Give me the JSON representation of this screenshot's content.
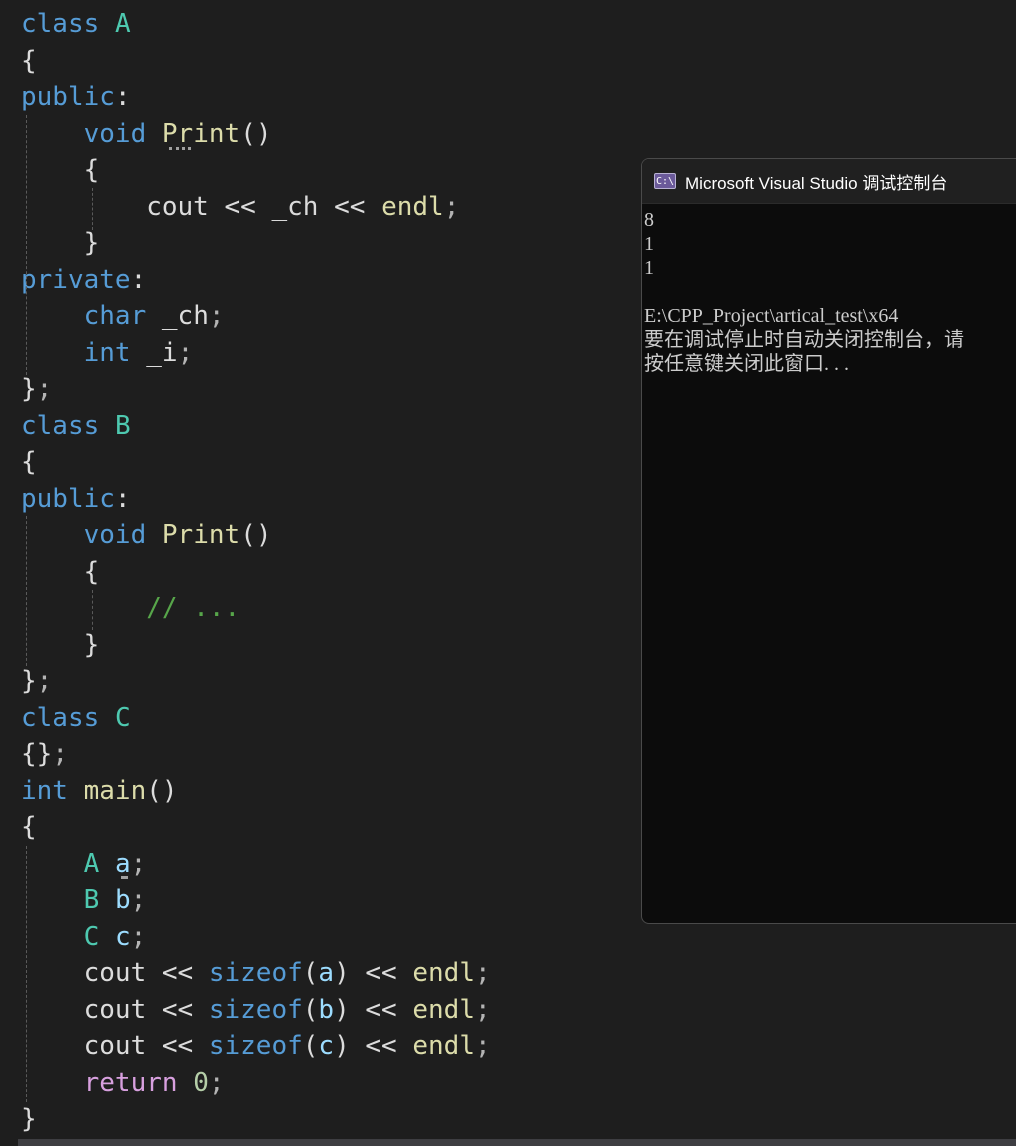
{
  "editor": {
    "lines": [
      {
        "tokens": [
          {
            "text": "class",
            "color": "#569cd6"
          },
          {
            "text": " "
          },
          {
            "text": "A",
            "color": "#4ec9b0"
          }
        ]
      },
      {
        "tokens": [
          {
            "text": "{"
          }
        ]
      },
      {
        "tokens": [
          {
            "text": "public",
            "color": "#569cd6"
          },
          {
            "text": ":"
          }
        ]
      },
      {
        "tokens": [
          {
            "text": "    "
          },
          {
            "text": "void",
            "color": "#569cd6"
          },
          {
            "text": " "
          },
          {
            "text": "Print",
            "color": "#dcdcaa"
          },
          {
            "text": "()"
          }
        ]
      },
      {
        "tokens": [
          {
            "text": "    {"
          }
        ]
      },
      {
        "tokens": [
          {
            "text": "        cout",
            "color": "#dcdcdc"
          },
          {
            "text": " << "
          },
          {
            "text": "_ch",
            "color": "#dadada"
          },
          {
            "text": " << "
          },
          {
            "text": "endl",
            "color": "#dcdcaa"
          },
          {
            "text": ";",
            "color": "#b4b4b4"
          }
        ]
      },
      {
        "tokens": [
          {
            "text": "    }"
          }
        ]
      },
      {
        "tokens": [
          {
            "text": "private",
            "color": "#569cd6"
          },
          {
            "text": ":"
          }
        ]
      },
      {
        "tokens": [
          {
            "text": "    "
          },
          {
            "text": "char",
            "color": "#569cd6"
          },
          {
            "text": " _ch"
          },
          {
            "text": ";",
            "color": "#b4b4b4"
          }
        ]
      },
      {
        "tokens": [
          {
            "text": "    "
          },
          {
            "text": "int",
            "color": "#569cd6"
          },
          {
            "text": " _i"
          },
          {
            "text": ";",
            "color": "#b4b4b4"
          }
        ]
      },
      {
        "tokens": [
          {
            "text": "}"
          },
          {
            "text": ";",
            "color": "#b4b4b4"
          }
        ]
      },
      {
        "tokens": [
          {
            "text": "class",
            "color": "#569cd6"
          },
          {
            "text": " "
          },
          {
            "text": "B",
            "color": "#4ec9b0"
          }
        ]
      },
      {
        "tokens": [
          {
            "text": "{"
          }
        ]
      },
      {
        "tokens": [
          {
            "text": "public",
            "color": "#569cd6"
          },
          {
            "text": ":"
          }
        ]
      },
      {
        "tokens": [
          {
            "text": "    "
          },
          {
            "text": "void",
            "color": "#569cd6"
          },
          {
            "text": " "
          },
          {
            "text": "Print",
            "color": "#dcdcaa"
          },
          {
            "text": "()"
          }
        ]
      },
      {
        "tokens": [
          {
            "text": "    {"
          }
        ]
      },
      {
        "tokens": [
          {
            "text": "        "
          },
          {
            "text": "// ...",
            "color": "#57a64a"
          }
        ]
      },
      {
        "tokens": [
          {
            "text": "    }"
          }
        ]
      },
      {
        "tokens": [
          {
            "text": "}"
          },
          {
            "text": ";",
            "color": "#b4b4b4"
          }
        ]
      },
      {
        "tokens": [
          {
            "text": "class",
            "color": "#569cd6"
          },
          {
            "text": " "
          },
          {
            "text": "C",
            "color": "#4ec9b0"
          }
        ]
      },
      {
        "tokens": [
          {
            "text": "{}"
          },
          {
            "text": ";",
            "color": "#b4b4b4"
          }
        ]
      },
      {
        "tokens": [
          {
            "text": "int",
            "color": "#569cd6"
          },
          {
            "text": " "
          },
          {
            "text": "main",
            "color": "#dcdcaa"
          },
          {
            "text": "()"
          }
        ]
      },
      {
        "tokens": [
          {
            "text": "{"
          }
        ]
      },
      {
        "tokens": [
          {
            "text": "    "
          },
          {
            "text": "A",
            "color": "#4ec9b0"
          },
          {
            "text": " "
          },
          {
            "text": "a",
            "color": "#9cdcfe"
          },
          {
            "text": ";",
            "color": "#b4b4b4"
          }
        ]
      },
      {
        "tokens": [
          {
            "text": "    "
          },
          {
            "text": "B",
            "color": "#4ec9b0"
          },
          {
            "text": " "
          },
          {
            "text": "b",
            "color": "#9cdcfe"
          },
          {
            "text": ";",
            "color": "#b4b4b4"
          }
        ]
      },
      {
        "tokens": [
          {
            "text": "    "
          },
          {
            "text": "C",
            "color": "#4ec9b0"
          },
          {
            "text": " "
          },
          {
            "text": "c",
            "color": "#9cdcfe"
          },
          {
            "text": ";",
            "color": "#b4b4b4"
          }
        ]
      },
      {
        "tokens": [
          {
            "text": "    cout << "
          },
          {
            "text": "sizeof",
            "color": "#569cd6"
          },
          {
            "text": "("
          },
          {
            "text": "a",
            "color": "#9cdcfe"
          },
          {
            "text": ") << "
          },
          {
            "text": "endl",
            "color": "#dcdcaa"
          },
          {
            "text": ";",
            "color": "#b4b4b4"
          }
        ]
      },
      {
        "tokens": [
          {
            "text": "    cout << "
          },
          {
            "text": "sizeof",
            "color": "#569cd6"
          },
          {
            "text": "("
          },
          {
            "text": "b",
            "color": "#9cdcfe"
          },
          {
            "text": ") << "
          },
          {
            "text": "endl",
            "color": "#dcdcaa"
          },
          {
            "text": ";",
            "color": "#b4b4b4"
          }
        ]
      },
      {
        "tokens": [
          {
            "text": "    cout << "
          },
          {
            "text": "sizeof",
            "color": "#569cd6"
          },
          {
            "text": "("
          },
          {
            "text": "c",
            "color": "#9cdcfe"
          },
          {
            "text": ") << "
          },
          {
            "text": "endl",
            "color": "#dcdcaa"
          },
          {
            "text": ";",
            "color": "#b4b4b4"
          }
        ]
      },
      {
        "tokens": [
          {
            "text": "    "
          },
          {
            "text": "return",
            "color": "#d8a0df"
          },
          {
            "text": " "
          },
          {
            "text": "0",
            "color": "#b5cea8"
          },
          {
            "text": ";",
            "color": "#b4b4b4"
          }
        ]
      },
      {
        "tokens": [
          {
            "text": "}"
          }
        ]
      }
    ]
  },
  "console": {
    "title": "Microsoft Visual Studio 调试控制台",
    "icon": "C:\\",
    "lines": [
      "8",
      "1",
      "1",
      "",
      "E:\\CPP_Project\\artical_test\\x64",
      "要在调试停止时自动关闭控制台，请",
      "按任意键关闭此窗口. . ."
    ]
  },
  "colors": {
    "editor_background": "#1e1e1e",
    "keyword": "#569cd6",
    "type_name": "#4ec9b0",
    "function_name": "#dcdcaa",
    "variable": "#9cdcfe",
    "comment": "#57a64a",
    "control_keyword": "#d8a0df",
    "number": "#b5cea8",
    "console_background": "#0c0c0c"
  }
}
